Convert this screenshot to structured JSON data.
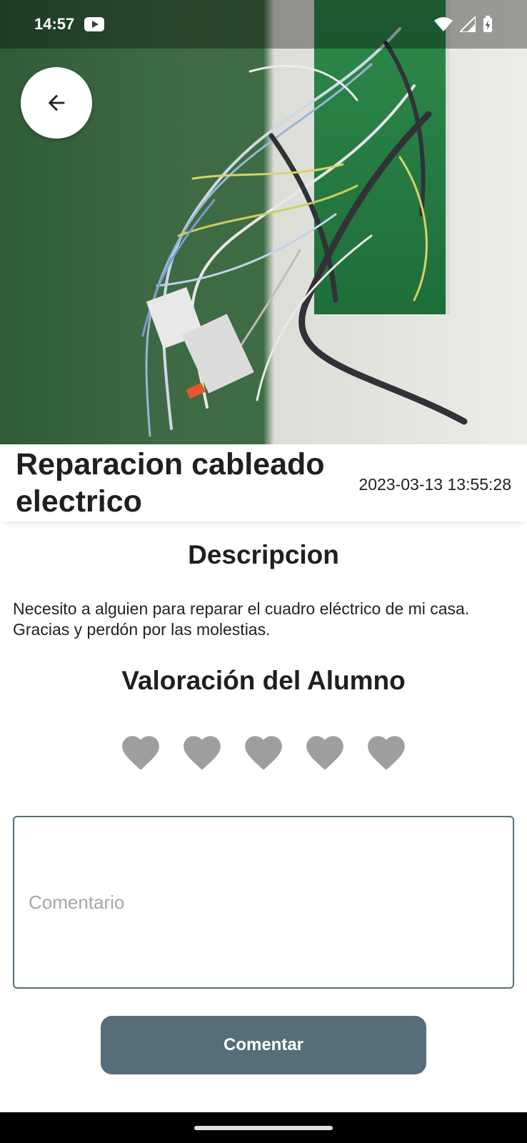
{
  "status_bar": {
    "time": "14:57",
    "icons": [
      "youtube-icon",
      "wifi-icon",
      "cell-signal-icon",
      "battery-charging-icon"
    ]
  },
  "hero": {
    "image": "tangled electrical wires coming out of a green wall box"
  },
  "job": {
    "title": "Reparacion cableado electrico",
    "date": "2023-03-13 13:55:28"
  },
  "description": {
    "heading": "Descripcion",
    "text": "Necesito a alguien para reparar el cuadro eléctrico de mi casa. Gracias y perdón por las molestias."
  },
  "rating": {
    "heading": "Valoración del Alumno",
    "max": 5,
    "value": 0,
    "inactive_color": "#9e9e9e"
  },
  "comment": {
    "placeholder": "Comentario",
    "value": "",
    "button_label": "Comentar",
    "button_color": "#566d7a"
  }
}
